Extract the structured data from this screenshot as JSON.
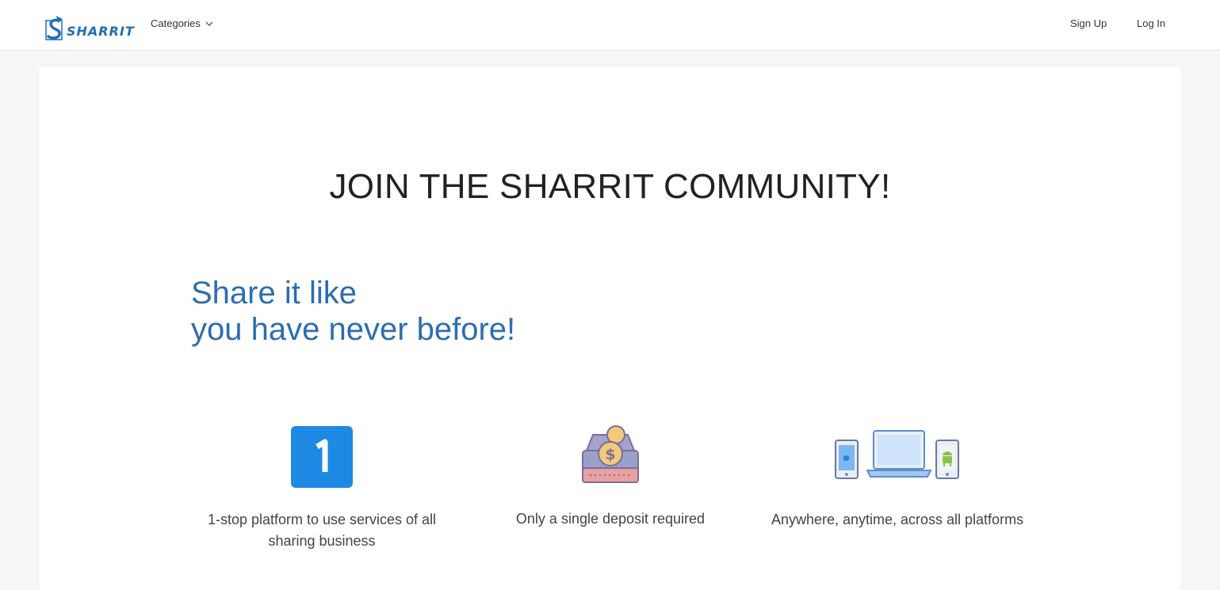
{
  "nav": {
    "logo_text": "SHARRIT",
    "categories_label": "Categories",
    "signup_label": "Sign Up",
    "login_label": "Log In"
  },
  "hero": {
    "headline": "JOIN THE SHARRIT COMMUNITY!",
    "tagline_line1": "Share it like",
    "tagline_line2": "you have never before!"
  },
  "features": [
    {
      "icon": "number-one-icon",
      "text": "1-stop platform to use services of all sharing business"
    },
    {
      "icon": "deposit-box-icon",
      "text": "Only a single deposit required"
    },
    {
      "icon": "multi-device-icon",
      "text": "Anywhere, anytime, across all platforms"
    }
  ],
  "colors": {
    "brand_blue": "#2d6db0",
    "logo_blue": "#1f6fb5",
    "icon_blue": "#1e88e5",
    "headline_dark": "#222222"
  }
}
